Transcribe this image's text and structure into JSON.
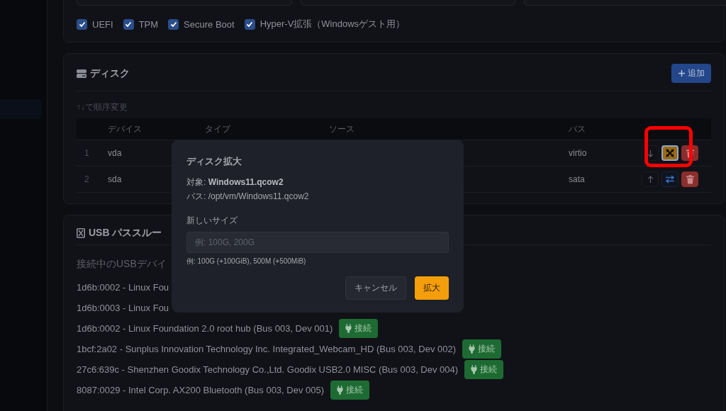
{
  "vm_options": {
    "checkboxes": [
      {
        "label": "UEFI",
        "checked": true
      },
      {
        "label": "TPM",
        "checked": true
      },
      {
        "label": "Secure Boot",
        "checked": true
      },
      {
        "label": "Hyper-V拡張（Windowsゲスト用）",
        "checked": true
      }
    ]
  },
  "disks": {
    "title": "ディスク",
    "add_button": "追加",
    "hint": "↑↓で順序変更",
    "columns": [
      "デバイス",
      "タイプ",
      "ソース",
      "バス"
    ],
    "rows": [
      {
        "index": "1",
        "device": "vda",
        "bus": "virtio",
        "actions": [
          {
            "kind": "down",
            "focused": false
          },
          {
            "kind": "resize",
            "focused": true
          },
          {
            "kind": "delete",
            "focused": false
          }
        ]
      },
      {
        "index": "2",
        "device": "sda",
        "bus": "sata",
        "actions": [
          {
            "kind": "up",
            "focused": false
          },
          {
            "kind": "swap",
            "focused": false
          },
          {
            "kind": "delete",
            "focused": false
          }
        ]
      }
    ]
  },
  "usb": {
    "title": "USB パススルー",
    "subtitle": "接続中のUSBデバイ",
    "devices": [
      {
        "name": "1d6b:0002 - Linux Fou"
      },
      {
        "name": "1d6b:0003 - Linux Fou"
      },
      {
        "name": "1d6b:0002 - Linux Foundation 2.0 root hub (Bus 003, Dev 001)",
        "connect": "接続"
      },
      {
        "name": "1bcf:2a02 - Sunplus Innovation Technology Inc. Integrated_Webcam_HD (Bus 003, Dev 002)",
        "connect": "接続"
      },
      {
        "name": "27c6:639c - Shenzhen Goodix Technology Co.,Ltd. Goodix USB2.0 MISC (Bus 003, Dev 004)",
        "connect": "接続"
      },
      {
        "name": "8087:0029 - Intel Corp. AX200 Bluetooth (Bus 003, Dev 005)",
        "connect": "接続"
      }
    ]
  },
  "dialog": {
    "title": "ディスク拡大",
    "target": "対象: **Windows11.qcow2**",
    "path": "パス: /opt/vm/Windows11.qcow2",
    "field_label": "新しいサイズ",
    "placeholder": "例: 100G, 200G",
    "help": "例: 100G (+100GiB), 500M (+500MiB)",
    "cancel": "キャンセル",
    "confirm": "拡大"
  }
}
